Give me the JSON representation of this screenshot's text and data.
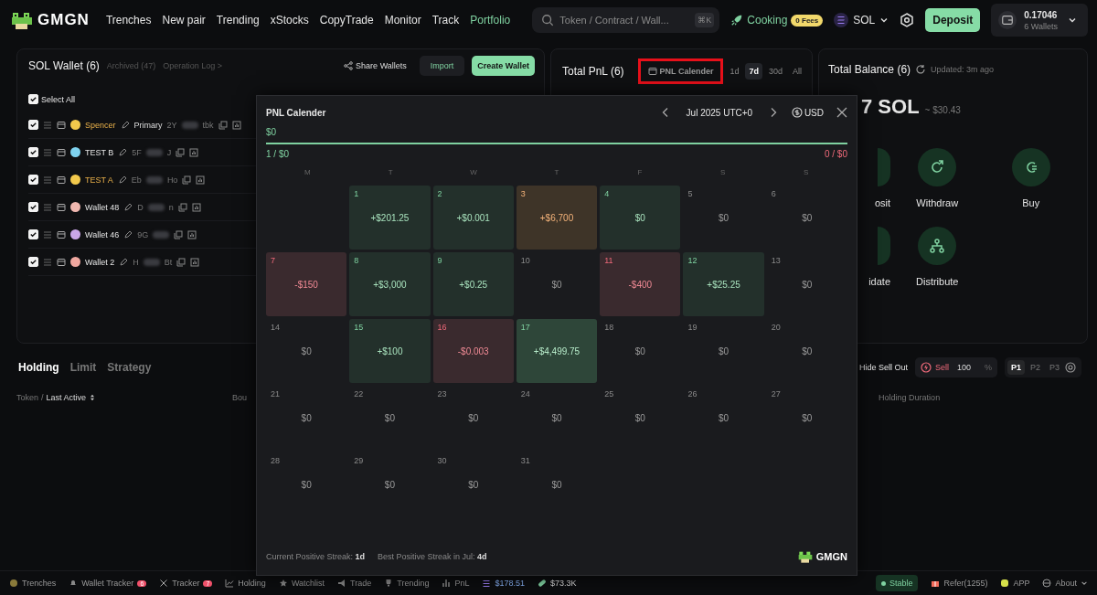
{
  "nav": {
    "brand": "GMGN",
    "links": [
      {
        "label": "Trenches",
        "selected": false
      },
      {
        "label": "New pair",
        "selected": false
      },
      {
        "label": "Trending",
        "selected": false
      },
      {
        "label": "xStocks",
        "selected": false
      },
      {
        "label": "CopyTrade",
        "selected": false
      },
      {
        "label": "Monitor",
        "selected": false
      },
      {
        "label": "Track",
        "selected": false
      },
      {
        "label": "Portfolio",
        "selected": true
      }
    ],
    "search": {
      "placeholder": "Token / Contract / Wall...",
      "shortcut": "⌘K"
    },
    "cooking": "Cooking",
    "fees_badge": "0 Fees",
    "chain": "SOL",
    "deposit": "Deposit",
    "wallet_balance": "0.17046",
    "wallet_count": "6 Wallets"
  },
  "wallets_card": {
    "title": "SOL Wallet (6)",
    "archived": "Archived (47)",
    "operation_log": "Operation Log >",
    "share": "Share Wallets",
    "import": "Import",
    "create": "Create Wallet",
    "select_all": {
      "label": "Select All",
      "checked": true
    },
    "rows": [
      {
        "name": "Spencer",
        "highlighted": true,
        "avatar": {
          "color": "#f2c94c"
        },
        "primary": "Primary",
        "addr_start": "2Y",
        "addr_end": "tbk",
        "checked": true
      },
      {
        "name": "TEST B",
        "highlighted": false,
        "avatar": {
          "color": "#7fd3f0"
        },
        "addr_start": "5F",
        "addr_end": "J",
        "checked": true
      },
      {
        "name": "TEST A",
        "highlighted": true,
        "avatar": {
          "color": "#f2c94c"
        },
        "addr_start": "Eb",
        "addr_end": "Ho",
        "checked": true
      },
      {
        "name": "Wallet 48",
        "highlighted": false,
        "avatar": {
          "color": "#f0b8b0"
        },
        "addr_start": "D",
        "addr_end": "n",
        "checked": true
      },
      {
        "name": "Wallet 46",
        "highlighted": false,
        "avatar": {
          "color": "#c9a6e8"
        },
        "addr_start": "9G",
        "addr_end": "",
        "checked": true
      },
      {
        "name": "Wallet 2",
        "highlighted": false,
        "avatar": {
          "color": "#f0a8a0"
        },
        "addr_start": "H",
        "addr_end": "Bt",
        "checked": true
      }
    ]
  },
  "pnl_card": {
    "title": "Total PnL (6)",
    "calendar_button": {
      "label": "PNL Calender",
      "highlighted": true
    },
    "periods": [
      {
        "label": "1d",
        "selected": false
      },
      {
        "label": "7d",
        "selected": true
      },
      {
        "label": "30d",
        "selected": false
      },
      {
        "label": "All",
        "selected": false
      }
    ]
  },
  "balance_card": {
    "title": "Total Balance (6)",
    "updated": "Updated: 3m ago",
    "amount": "7 SOL",
    "usd": "~ $30.43",
    "actions": [
      {
        "label": "osit",
        "kind": "cut"
      },
      {
        "label": "Withdraw",
        "kind": "withdraw"
      },
      {
        "label": "Buy",
        "kind": "buy"
      },
      {
        "label": "idate",
        "kind": "cut"
      },
      {
        "label": "Distribute",
        "kind": "distribute"
      }
    ]
  },
  "holdings": {
    "tabs": [
      {
        "label": "Holding",
        "selected": true
      },
      {
        "label": "Limit",
        "selected": false
      },
      {
        "label": "Strategy",
        "selected": false
      }
    ],
    "hide_sell_out": {
      "label": "Hide Sell Out"
    },
    "sell": {
      "label": "Sell",
      "value": "100",
      "unit": "%"
    },
    "presets": [
      {
        "label": "P1",
        "selected": true
      },
      {
        "label": "P2",
        "selected": false
      },
      {
        "label": "P3",
        "selected": false
      }
    ],
    "columns": {
      "token": "Token",
      "separator": "/",
      "last_active": "Last Active",
      "column_3": "Bou",
      "holding_duration": "Holding Duration"
    }
  },
  "calendar": {
    "title": "PNL Calender",
    "month": "Jul 2025 UTC+0",
    "currency": "USD",
    "total": "$0",
    "wins": "1 / $0",
    "losses": "0 / $0",
    "weekdays": [
      "M",
      "T",
      "W",
      "T",
      "F",
      "S",
      "S"
    ],
    "weeks": [
      [
        {
          "kind": "blank"
        },
        {
          "day": "1",
          "value": "+$201.25",
          "kind": "gain"
        },
        {
          "day": "2",
          "value": "+$0.001",
          "kind": "gain"
        },
        {
          "day": "3",
          "value": "+$6,700",
          "kind": "best"
        },
        {
          "day": "4",
          "value": "$0",
          "kind": "gain"
        },
        {
          "day": "5",
          "value": "$0",
          "kind": "flat"
        },
        {
          "day": "6",
          "value": "$0",
          "kind": "flat"
        }
      ],
      [
        {
          "day": "7",
          "value": "-$150",
          "kind": "loss"
        },
        {
          "day": "8",
          "value": "+$3,000",
          "kind": "gain"
        },
        {
          "day": "9",
          "value": "+$0.25",
          "kind": "gain"
        },
        {
          "day": "10",
          "value": "$0",
          "kind": "flat"
        },
        {
          "day": "11",
          "value": "-$400",
          "kind": "loss"
        },
        {
          "day": "12",
          "value": "+$25.25",
          "kind": "gain"
        },
        {
          "day": "13",
          "value": "$0",
          "kind": "flat"
        }
      ],
      [
        {
          "day": "14",
          "value": "$0",
          "kind": "flat"
        },
        {
          "day": "15",
          "value": "+$100",
          "kind": "gain"
        },
        {
          "day": "16",
          "value": "-$0.003",
          "kind": "loss"
        },
        {
          "day": "17",
          "value": "+$4,499.75",
          "kind": "strong"
        },
        {
          "day": "18",
          "value": "$0",
          "kind": "flat"
        },
        {
          "day": "19",
          "value": "$0",
          "kind": "flat"
        },
        {
          "day": "20",
          "value": "$0",
          "kind": "flat"
        }
      ],
      [
        {
          "day": "21",
          "value": "$0",
          "kind": "flat"
        },
        {
          "day": "22",
          "value": "$0",
          "kind": "flat"
        },
        {
          "day": "23",
          "value": "$0",
          "kind": "flat"
        },
        {
          "day": "24",
          "value": "$0",
          "kind": "flat"
        },
        {
          "day": "25",
          "value": "$0",
          "kind": "flat"
        },
        {
          "day": "26",
          "value": "$0",
          "kind": "flat"
        },
        {
          "day": "27",
          "value": "$0",
          "kind": "flat"
        }
      ],
      [
        {
          "day": "28",
          "value": "$0",
          "kind": "flat"
        },
        {
          "day": "29",
          "value": "$0",
          "kind": "flat"
        },
        {
          "day": "30",
          "value": "$0",
          "kind": "flat"
        },
        {
          "day": "31",
          "value": "$0",
          "kind": "flat"
        },
        {
          "kind": "blank"
        },
        {
          "kind": "blank"
        },
        {
          "kind": "blank"
        }
      ]
    ],
    "current_streak": "Current Positive Streak: **1d**",
    "best_streak": "Best Positive Streak in Jul: **4d**",
    "brand": "GMGN"
  },
  "footer": {
    "items": [
      {
        "label": "Trenches",
        "kind": "trenches"
      },
      {
        "label": "Wallet Tracker",
        "kind": "bell",
        "badge": "6"
      },
      {
        "label": "Tracker",
        "kind": "x",
        "badge": "7"
      },
      {
        "label": "Holding",
        "kind": "chart"
      },
      {
        "label": "Watchlist",
        "kind": "star"
      },
      {
        "label": "Trade",
        "kind": "trade"
      },
      {
        "label": "Trending",
        "kind": "trophy"
      },
      {
        "label": "PnL",
        "kind": "bars"
      }
    ],
    "sol_price": "$178.51",
    "volume": "$73.3K",
    "stable": "Stable",
    "refer": "Refer(1255)",
    "app": "APP",
    "about": "About"
  }
}
